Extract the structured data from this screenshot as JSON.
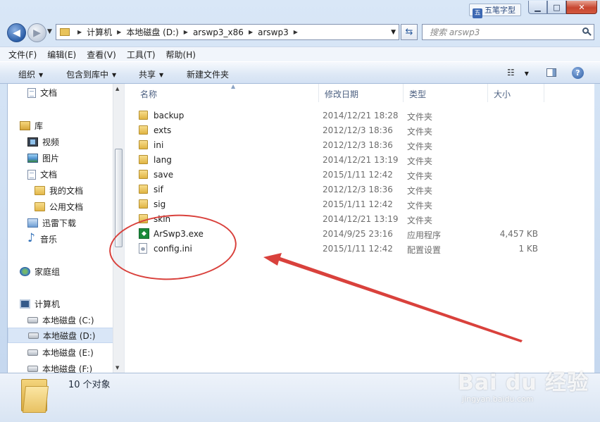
{
  "window": {
    "ime_label": "五笔字型",
    "controls": {
      "minimize": "▁",
      "maximize": "□",
      "close": "✕"
    }
  },
  "address": {
    "crumbs": [
      "计算机",
      "本地磁盘 (D:)",
      "arswp3_x86",
      "arswp3"
    ],
    "search_placeholder": "搜索 arswp3"
  },
  "menu": [
    "文件(F)",
    "编辑(E)",
    "查看(V)",
    "工具(T)",
    "帮助(H)"
  ],
  "commands": {
    "organize": "组织",
    "include_library": "包含到库中",
    "share": "共享",
    "new_folder": "新建文件夹"
  },
  "nav_pane": {
    "items": [
      {
        "label": "文档",
        "icon": "document-icon"
      },
      {
        "label": "库",
        "icon": "library-icon"
      },
      {
        "label": "视频",
        "icon": "video-icon"
      },
      {
        "label": "图片",
        "icon": "picture-icon"
      },
      {
        "label": "文档",
        "icon": "document-icon"
      },
      {
        "label": "我的文档",
        "icon": "folder-icon"
      },
      {
        "label": "公用文档",
        "icon": "folder-icon"
      },
      {
        "label": "迅雷下载",
        "icon": "xunlei-icon"
      },
      {
        "label": "音乐",
        "icon": "music-icon"
      },
      {
        "label": "家庭组",
        "icon": "homegroup-icon"
      },
      {
        "label": "计算机",
        "icon": "computer-icon"
      },
      {
        "label": "本地磁盘 (C:)",
        "icon": "drive-icon"
      },
      {
        "label": "本地磁盘 (D:)",
        "icon": "drive-icon",
        "selected": true
      },
      {
        "label": "本地磁盘 (E:)",
        "icon": "drive-icon"
      },
      {
        "label": "本地磁盘 (F:)",
        "icon": "drive-icon"
      }
    ]
  },
  "columns": {
    "name": "名称",
    "date": "修改日期",
    "type": "类型",
    "size": "大小"
  },
  "files": [
    {
      "name": "backup",
      "date": "2014/12/21 18:28",
      "type": "文件夹",
      "size": "",
      "kind": "folder"
    },
    {
      "name": "exts",
      "date": "2012/12/3 18:36",
      "type": "文件夹",
      "size": "",
      "kind": "folder"
    },
    {
      "name": "ini",
      "date": "2012/12/3 18:36",
      "type": "文件夹",
      "size": "",
      "kind": "folder"
    },
    {
      "name": "lang",
      "date": "2014/12/21 13:19",
      "type": "文件夹",
      "size": "",
      "kind": "folder"
    },
    {
      "name": "save",
      "date": "2015/1/11 12:42",
      "type": "文件夹",
      "size": "",
      "kind": "folder"
    },
    {
      "name": "sif",
      "date": "2012/12/3 18:36",
      "type": "文件夹",
      "size": "",
      "kind": "folder"
    },
    {
      "name": "sig",
      "date": "2015/1/11 12:42",
      "type": "文件夹",
      "size": "",
      "kind": "folder"
    },
    {
      "name": "skin",
      "date": "2014/12/21 13:19",
      "type": "文件夹",
      "size": "",
      "kind": "folder"
    },
    {
      "name": "ArSwp3.exe",
      "date": "2014/9/25 23:16",
      "type": "应用程序",
      "size": "4,457 KB",
      "kind": "exe"
    },
    {
      "name": "config.ini",
      "date": "2015/1/11 12:42",
      "type": "配置设置",
      "size": "1 KB",
      "kind": "ini"
    }
  ],
  "status": {
    "item_count": "10 个对象"
  },
  "annotation_color": "#d9413c",
  "watermark": {
    "main": "Bai du 经验",
    "sub": "jingyan.baidu.com"
  }
}
